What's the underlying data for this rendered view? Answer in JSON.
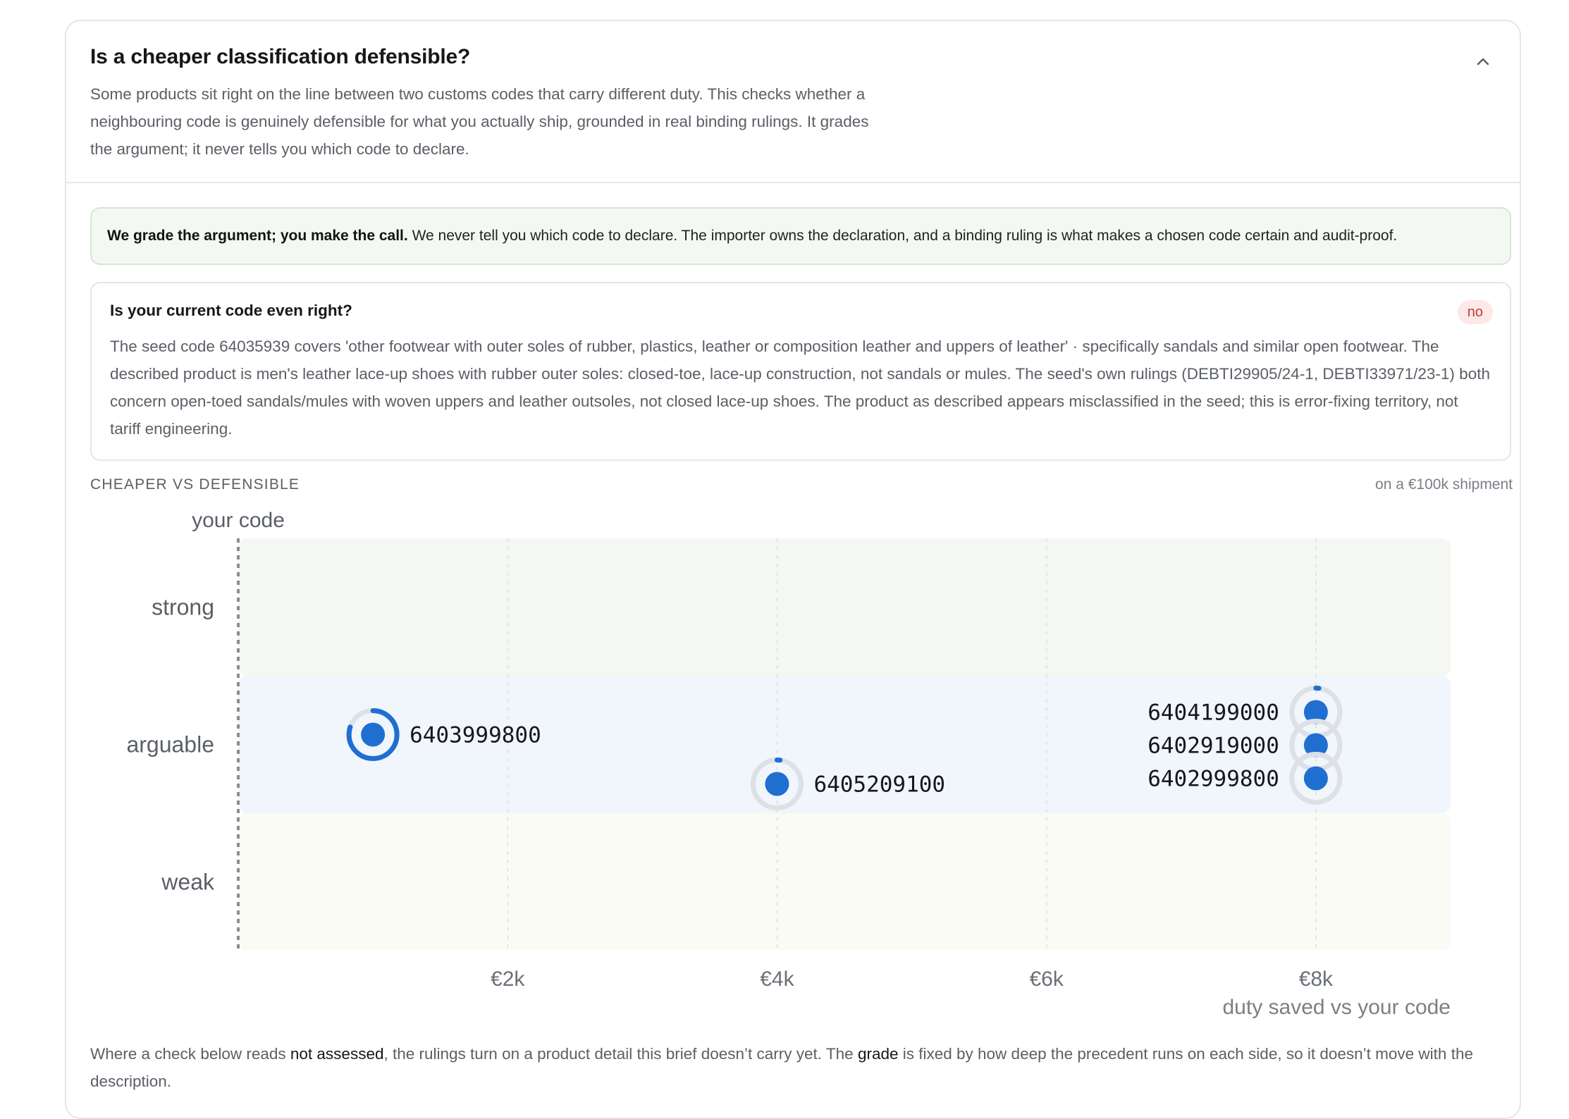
{
  "card": {
    "title": "Is a cheaper classification defensible?",
    "subtitle": "Some products sit right on the line between two customs codes that carry different duty. This checks whether a neighbouring code is genuinely defensible for what you actually ship, grounded in real binding rulings. It grades the argument; it never tells you which code to declare.",
    "collapse_icon": "chevron-up-icon"
  },
  "notice": {
    "bold": "We grade the argument; you make the call.",
    "text": " We never tell you which code to declare. The importer owns the declaration, and a binding ruling is what makes a chosen code certain and audit-proof."
  },
  "verdict": {
    "title": "Is your current code even right?",
    "badge": "no",
    "badge_color": "#c23b3b",
    "body": "The seed code 64035939 covers 'other footwear with outer soles of rubber, plastics, leather or composition leather and uppers of leather' · specifically sandals and similar open footwear. The described product is men's leather lace-up shoes with rubber outer soles: closed-toe, lace-up construction, not sandals or mules. The seed's own rulings (DEBTI29905/24-1, DEBTI33971/23-1) both concern open-toed sandals/mules with woven uppers and leather outsoles, not closed lace-up shoes. The product as described appears misclassified in the seed; this is error-fixing territory, not tariff engineering."
  },
  "chart_section": {
    "label": "CHEAPER VS DEFENSIBLE",
    "note": "on a €100k shipment"
  },
  "chart_data": {
    "type": "scatter",
    "baseline_label": "your code",
    "xlabel": "duty saved vs your code",
    "x_ticks": [
      "€2k",
      "€4k",
      "€6k",
      "€8k"
    ],
    "x_tick_values": [
      2000,
      4000,
      6000,
      8000
    ],
    "xlim": [
      0,
      9000
    ],
    "bands": [
      {
        "name": "strong",
        "color": "#f4f7f2"
      },
      {
        "name": "arguable",
        "color": "#f1f5fc"
      },
      {
        "name": "weak",
        "color": "#fbfbf5"
      }
    ],
    "points": [
      {
        "code": "6403999800",
        "x": 1000,
        "band": "arguable",
        "confidence": 0.8
      },
      {
        "code": "6405209100",
        "x": 4000,
        "band": "arguable",
        "confidence": 0.02
      },
      {
        "code": "6404199000",
        "x": 8000,
        "band": "arguable",
        "confidence": 0.02
      },
      {
        "code": "6402919000",
        "x": 8000,
        "band": "arguable",
        "confidence": 0.0
      },
      {
        "code": "6402999800",
        "x": 8000,
        "band": "arguable",
        "confidence": 0.0
      }
    ],
    "point_color": "#1f6fd1",
    "grid": true
  },
  "footer": {
    "p1": "Where a check below reads ",
    "b1": "not assessed",
    "p2": ", the rulings turn on a product detail this brief doesn’t carry yet. The ",
    "b2": "grade",
    "p3": " is fixed by how deep the precedent runs on each side, so it doesn’t move with the description."
  }
}
